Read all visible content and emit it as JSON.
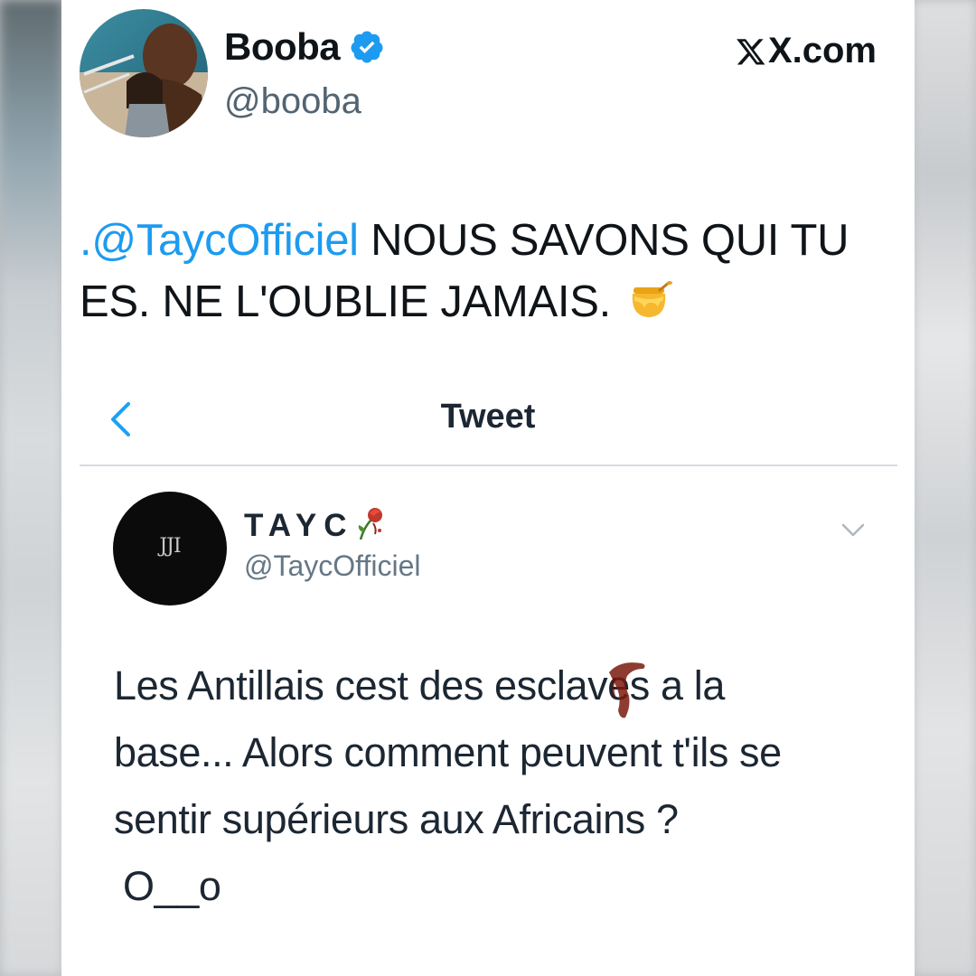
{
  "post": {
    "author_name": "Booba",
    "author_handle": "@booba",
    "source_label": "X.com",
    "mention": ".@TaycOfficiel",
    "text": " NOUS SAVONS QUI TU ES. NE L'OUBLIE JAMAIS.",
    "emoji": "honey-pot"
  },
  "embedded_screenshot": {
    "nav_title": "Tweet",
    "author_name": "TAYC",
    "author_handle": "@TaycOfficiel",
    "text_lines": [
      "Les Antillais cest des esclaves a la",
      "base... Alors comment peuvent t'ils se",
      "sentir supérieurs aux Africains ?",
      "O__o"
    ]
  },
  "colors": {
    "mention_blue": "#1d9bf0",
    "verified_blue": "#1d9bf0",
    "ios_link_blue": "#1da1f2",
    "blood_red": "#7a1a0d"
  },
  "icons": [
    "verified-badge-icon",
    "x-logo-icon",
    "honey-pot-icon",
    "back-chevron-icon",
    "wilted-rose-icon",
    "dropdown-caret-icon"
  ]
}
